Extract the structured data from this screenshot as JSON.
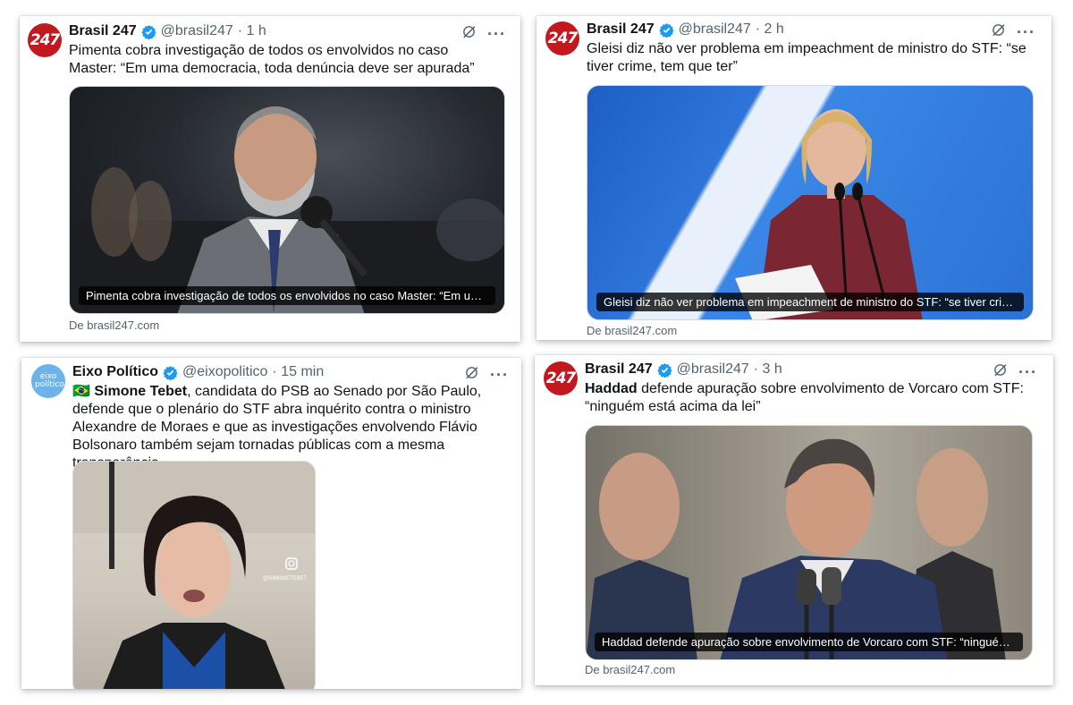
{
  "colors": {
    "brasil247_red": "#c1191f",
    "verified_blue": "#1d9bf0",
    "muted": "#536471"
  },
  "posts": [
    {
      "avatar_text": "247",
      "name": "Brasil 247",
      "handle": "@brasil247",
      "time": "· 1 h",
      "text": "Pimenta cobra investigação de todos os envolvidos no caso Master: “Em uma democracia, toda denúncia deve ser apurada”",
      "media_caption": "Pimenta cobra investigação de todos os envolvidos no caso Master: “Em uma democracia, toda denúncia deve ser apurada”",
      "source": "De brasil247.com"
    },
    {
      "avatar_text": "247",
      "name": "Brasil 247",
      "handle": "@brasil247",
      "time": "· 2 h",
      "text": "Gleisi diz não ver problema em impeachment de ministro do STF: “se tiver crime, tem que ter”",
      "media_caption": "Gleisi diz não ver problema em impeachment de ministro do STF: “se tiver crime, tem que ter”",
      "source": "De brasil247.com"
    },
    {
      "avatar_text": "eixo político",
      "name": "Eixo Político",
      "handle": "@eixopolitico",
      "time": "· 15 min",
      "flag": "🇧🇷",
      "bold_lead": "Simone Tebet",
      "text": ", candidata do PSB ao Senado por São Paulo, defende que o plenário do STF abra inquérito contra o ministro Alexandre de Moraes e que as investigações envolvendo Flávio Bolsonaro também sejam tornadas públicas com a mesma transparência.",
      "media_watermark": "@SIMONETEBET"
    },
    {
      "avatar_text": "247",
      "name": "Brasil 247",
      "handle": "@brasil247",
      "time": "· 3 h",
      "bold_lead": "Haddad",
      "text": " defende apuração sobre envolvimento de Vorcaro com STF: “ninguém está acima da lei”",
      "media_caption": "Haddad defende apuração sobre envolvimento de Vorcaro com STF: “ninguém está acima da lei”",
      "source": "De brasil247.com"
    }
  ]
}
